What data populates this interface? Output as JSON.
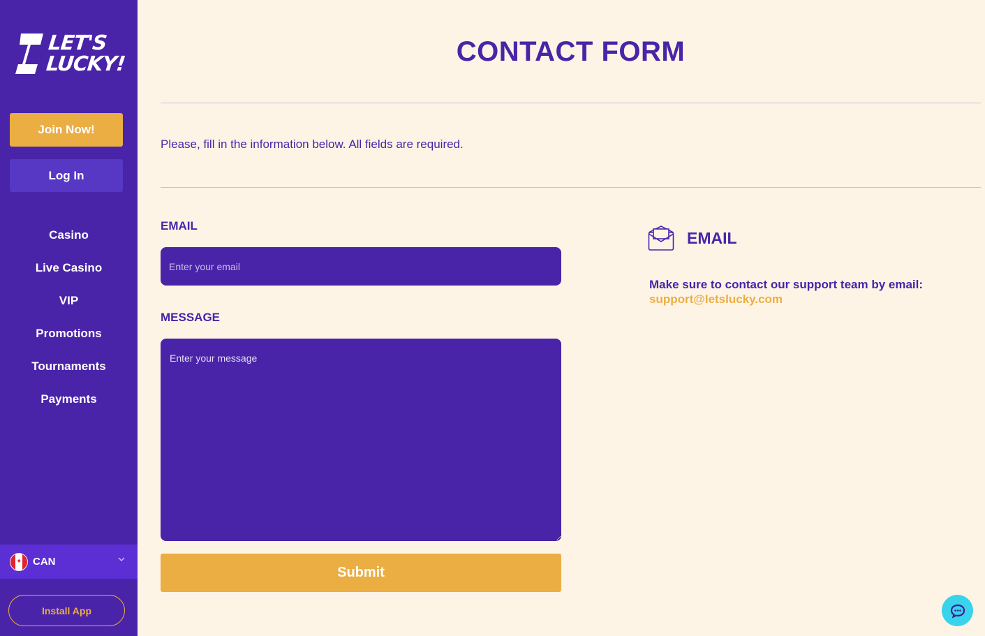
{
  "brand": {
    "logo_line1": "LET'S",
    "logo_line2": "LUCKY!"
  },
  "sidebar": {
    "join_label": "Join Now!",
    "login_label": "Log In",
    "nav": [
      {
        "label": "Casino"
      },
      {
        "label": "Live Casino"
      },
      {
        "label": "VIP"
      },
      {
        "label": "Promotions"
      },
      {
        "label": "Tournaments"
      },
      {
        "label": "Payments"
      }
    ],
    "language": {
      "code": "CAN",
      "flag_icon": "canada-flag-icon",
      "chevron_icon": "chevron-down-icon"
    },
    "install_label": "Install App"
  },
  "main": {
    "title": "CONTACT FORM",
    "intro": "Please, fill in the information below. All fields are required.",
    "email_label": "EMAIL",
    "email_placeholder": "Enter your email",
    "email_value": "",
    "message_label": "MESSAGE",
    "message_placeholder": "Enter your message",
    "message_value": "",
    "submit_label": "Submit"
  },
  "contact": {
    "icon": "envelope-icon",
    "title": "EMAIL",
    "text": "Make sure to contact our support team by email:",
    "email": "support@letslucky.com"
  },
  "chat": {
    "icon": "chat-icon"
  },
  "colors": {
    "sidebar_bg": "#4a24a8",
    "page_bg": "#fdf4e6",
    "accent": "#ebae43",
    "primary": "#4a24a8",
    "lang_bg": "#5b2fd4",
    "chat": "#3ad3ec"
  }
}
